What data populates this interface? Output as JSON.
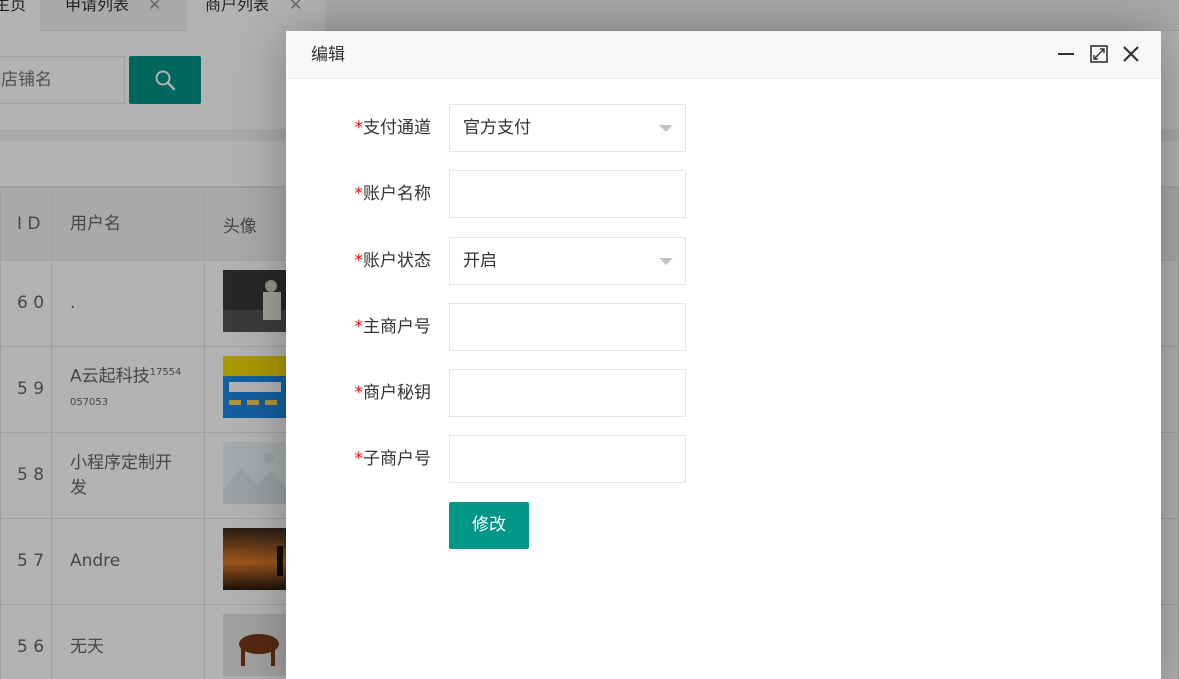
{
  "tabs": [
    {
      "label": "主页"
    },
    {
      "label": "申请列表",
      "close": "✕"
    },
    {
      "label": "商户列表",
      "close": "✕"
    }
  ],
  "search": {
    "placeholder": "店铺名",
    "button_icon": "search-icon"
  },
  "table": {
    "headers": [
      "I D",
      "用户名",
      "头像"
    ],
    "rows": [
      {
        "id": "6 0",
        "username": "."
      },
      {
        "id": "5 9",
        "username": "A云起科技",
        "username_suffix": "17554 057053"
      },
      {
        "id": "5 8",
        "username": "小程序定制开发"
      },
      {
        "id": "5 7",
        "username": "Andre"
      },
      {
        "id": "5 6",
        "username": "无天"
      }
    ]
  },
  "modal": {
    "title": "编辑",
    "fields": [
      {
        "label": "支付通道",
        "required_mark": "*",
        "value": "官方支付",
        "type": "select"
      },
      {
        "label": "账户名称",
        "required_mark": "*",
        "value": "",
        "type": "input"
      },
      {
        "label": "账户状态",
        "required_mark": "*",
        "value": "开启",
        "type": "select"
      },
      {
        "label": "主商户号",
        "required_mark": "*",
        "value": "",
        "type": "input"
      },
      {
        "label": "商户秘钥",
        "required_mark": "*",
        "value": "",
        "type": "input"
      },
      {
        "label": "子商户号",
        "required_mark": "*",
        "value": "",
        "type": "input"
      }
    ],
    "submit_label": "修改"
  },
  "colors": {
    "accent": "#009688",
    "required": "#ff0000"
  }
}
